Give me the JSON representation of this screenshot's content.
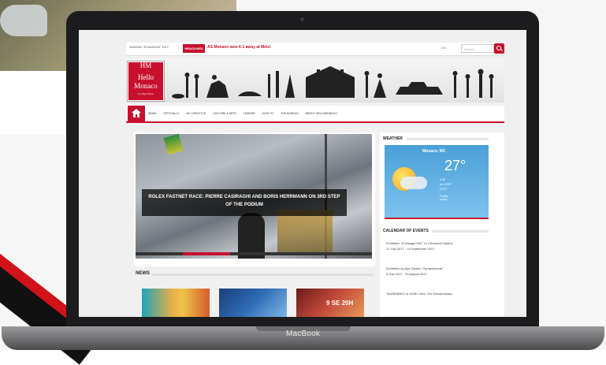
{
  "laptop": {
    "brand": "MacBook"
  },
  "site": {
    "topbar": {
      "date": "SUNDAY, 20 AUGUST 2017",
      "headline_badge": "HEADLINES",
      "ticker": "AS Monaco won 6-1 away at Metz!",
      "lang": "EN",
      "search_placeholder": "Search"
    },
    "logo": {
      "monogram": "HM",
      "line1": "Hello",
      "line2": "Monaco",
      "tagline": "by Olga Torres"
    },
    "nav": {
      "items": [
        "NEWS",
        "OFFICIALLY",
        "MC LIFESTYLE",
        "CULTURE & ARTS",
        "LEISURE",
        "HOW TO",
        "THE BUREAU",
        "ABOUT HELLOMONACO"
      ]
    },
    "slider": {
      "caption": "ROLEX FASTNET RACE: PIERRE CASIRAGHI AND BORIS HERRMANN ON 3RD STEP OF THE PODIUM"
    },
    "news": {
      "heading": "NEWS",
      "thumb3_text": "9 SE 20H"
    },
    "weather": {
      "title": "WEATHER",
      "city": "Monaco, MC",
      "temperature": "27°",
      "time": "4:36",
      "sunrise": "pm CEST",
      "timezone": "CEST",
      "condition": "Partly",
      "condition2": "sunny"
    },
    "calendar": {
      "title": "CALENDAR OF EVENTS",
      "events": [
        "Exhibition \"Envisaged MC\" in L'Entrepôt Gallery",
        "12 July 2017 - 15 September 2017",
        "Exhibition by Aya Takano \"Synaesthesia\"",
        "8 July 2017 - 20 August 2017",
        "\"NORMANDY 6 JUNE 1944: The Extraordinary"
      ]
    }
  }
}
